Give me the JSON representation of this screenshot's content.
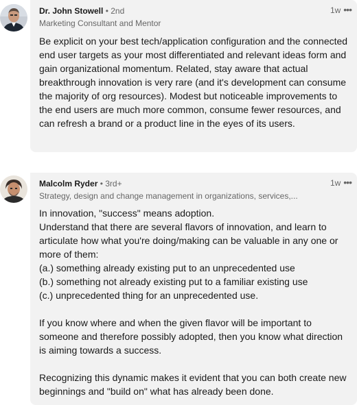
{
  "comments": [
    {
      "author": "Dr. John Stowell",
      "degree": "• 2nd",
      "headline": "Marketing Consultant and Mentor",
      "time": "1w",
      "more": "•••",
      "text": "Be explicit on your best tech/application configuration and the connected end user targets as your most differentiated and relevant ideas form and gain organizational momentum. Related, stay aware that actual breakthrough innovation is very rare (and it's development can consume the majority of org resources). Modest but noticeable improvements to the end users are much more common, consume fewer resources, and can refresh a brand or a product line in the eyes of its users."
    },
    {
      "author": "Malcolm Ryder",
      "degree": "• 3rd+",
      "headline": "Strategy, design and change management in organizations, services,...",
      "time": "1w",
      "more": "•••",
      "text": "In innovation, \"success\" means adoption.\nUnderstand that there are several flavors of innovation, and learn to articulate how what you're doing/making can be valuable in any one or more of them:\n(a.) something already existing put to an unprecedented use\n(b.) something not already existing put to a familiar existing use\n(c.) unprecedented thing for an unprecedented use.\n\nIf you know where and when the given flavor will be important to someone and therefore possibly adopted, then you know what direction is aiming towards a success.\n\nRecognizing this dynamic makes it evident that you can both create new beginnings and \"build on\" what has already been done."
    }
  ]
}
